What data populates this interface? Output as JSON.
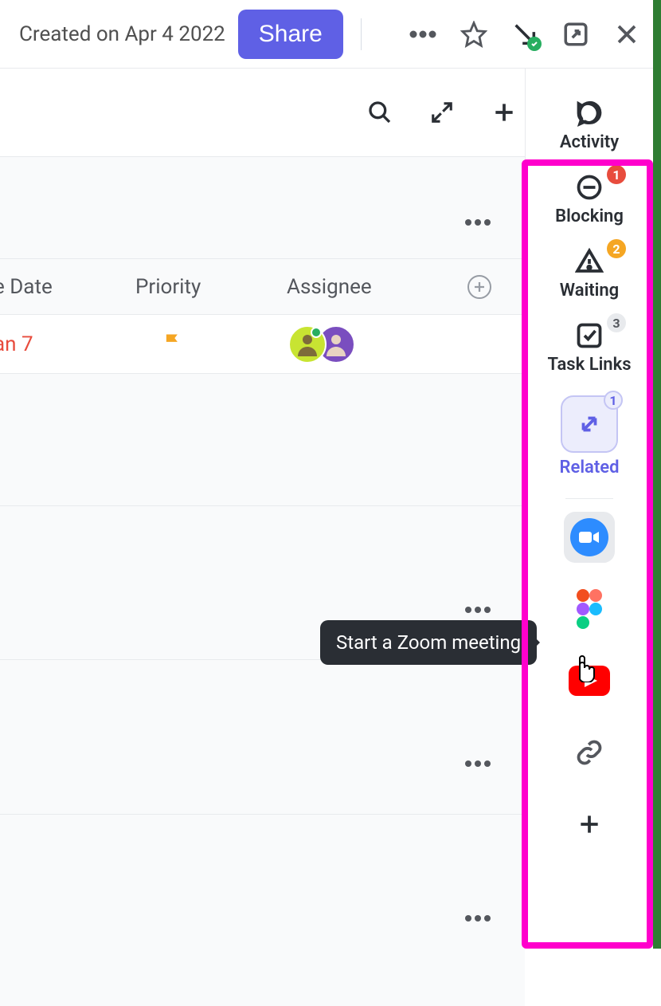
{
  "header": {
    "created_on": "Created on Apr 4 2022",
    "share_label": "Share"
  },
  "toolbar": {},
  "columns": {
    "date": "e Date",
    "priority": "Priority",
    "assignee": "Assignee"
  },
  "row": {
    "date": "an 7"
  },
  "sidebar": {
    "activity": {
      "label": "Activity"
    },
    "blocking": {
      "label": "Blocking",
      "badge": "1"
    },
    "waiting": {
      "label": "Waiting",
      "badge": "2"
    },
    "tasklinks": {
      "label": "Task Links",
      "badge": "3"
    },
    "related": {
      "label": "Related",
      "badge": "1"
    }
  },
  "tooltip": {
    "zoom": "Start a Zoom meeting"
  }
}
